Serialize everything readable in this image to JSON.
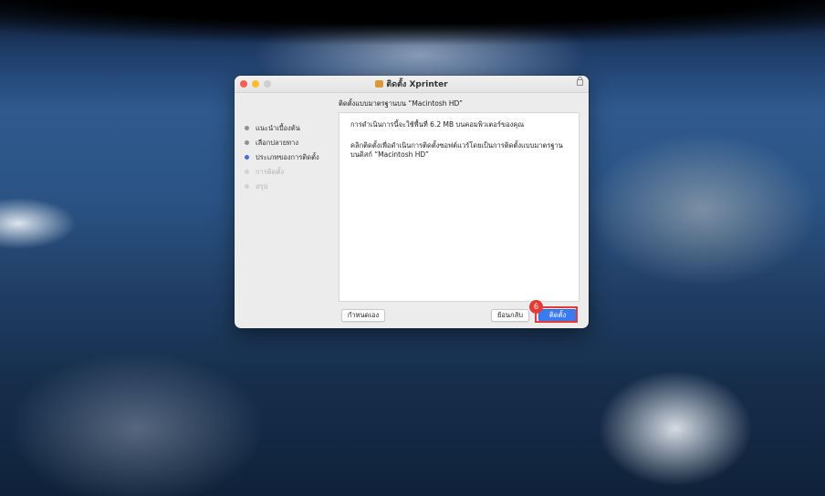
{
  "window": {
    "title": "ติดตั้ง Xprinter",
    "subtitle": "ติดตั้งแบบมาตรฐานบน “Macintosh HD”"
  },
  "sidebar": {
    "steps": [
      {
        "label": "แนะนำเบื้องต้น",
        "state": "done"
      },
      {
        "label": "เลือกปลายทาง",
        "state": "done"
      },
      {
        "label": "ประเภทของการติดตั้ง",
        "state": "active"
      },
      {
        "label": "การติดตั้ง",
        "state": "pending"
      },
      {
        "label": "สรุป",
        "state": "pending"
      }
    ]
  },
  "content": {
    "line1": "การดำเนินการนี้จะใช้พื้นที่ 6.2 MB บนคอมพิวเตอร์ของคุณ",
    "line2": "คลิกติดตั้งเพื่อดำเนินการติดตั้งซอฟต์แวร์โดยเป็นการติดตั้งแบบมาตรฐานบนดิสก์ “Macintosh HD”"
  },
  "buttons": {
    "customize": "กำหนดเอง",
    "back": "ย้อนกลับ",
    "install": "ติดตั้ง"
  },
  "annotation": {
    "step_number": "6",
    "color": "#e53935"
  },
  "icons": {
    "title_icon": "package-icon",
    "lock": "lock-icon"
  }
}
